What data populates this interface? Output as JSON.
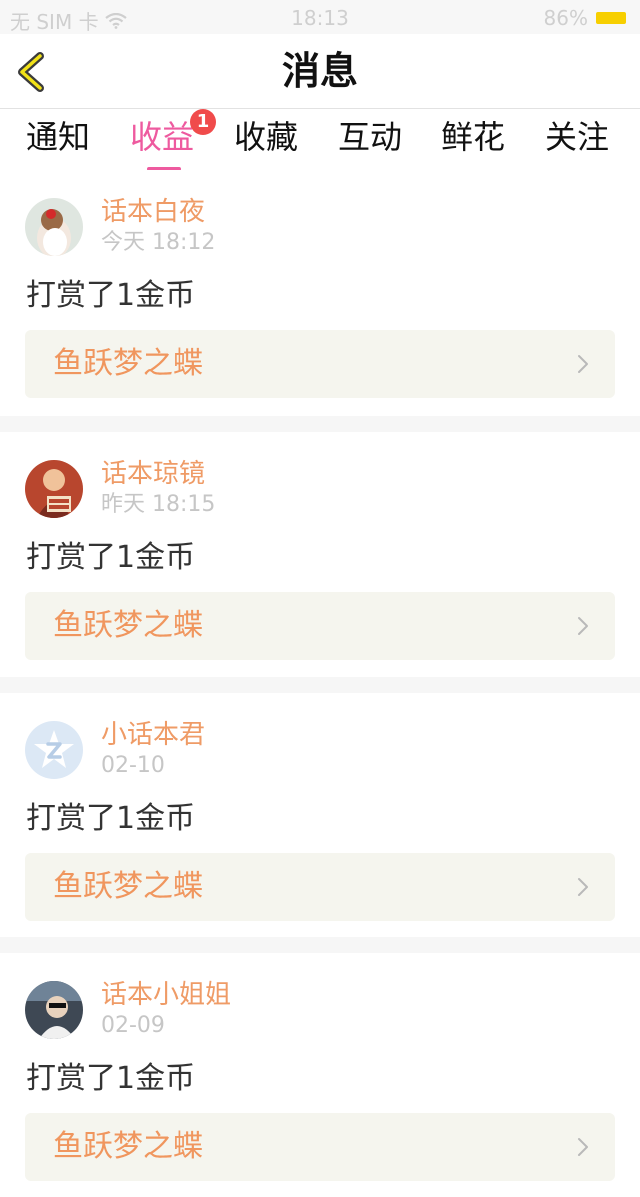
{
  "status_bar": {
    "carrier": "无 SIM 卡",
    "time": "18:13",
    "battery": "86%"
  },
  "nav": {
    "title": "消息",
    "back_icon": "chevron-left-icon"
  },
  "tabs": [
    {
      "label": "通知"
    },
    {
      "label": "收益",
      "active": true,
      "badge": "1"
    },
    {
      "label": "收藏"
    },
    {
      "label": "互动"
    },
    {
      "label": "鲜花"
    },
    {
      "label": "关注"
    }
  ],
  "colors": {
    "accent_pink": "#ee5a9f",
    "username_orange": "#ef9b66",
    "book_orange": "#f0965e",
    "badge_red": "#f04b4b"
  },
  "feed": [
    {
      "username": "话本白夜",
      "time": "今天 18:12",
      "message": "打赏了1金币",
      "book": "鱼跃梦之蝶"
    },
    {
      "username": "话本琼镜",
      "time": "昨天 18:15",
      "message": "打赏了1金币",
      "book": "鱼跃梦之蝶"
    },
    {
      "username": "小话本君",
      "time": "02-10",
      "message": "打赏了1金币",
      "book": "鱼跃梦之蝶"
    },
    {
      "username": "话本小姐姐",
      "time": "02-09",
      "message": "打赏了1金币",
      "book": "鱼跃梦之蝶"
    }
  ]
}
